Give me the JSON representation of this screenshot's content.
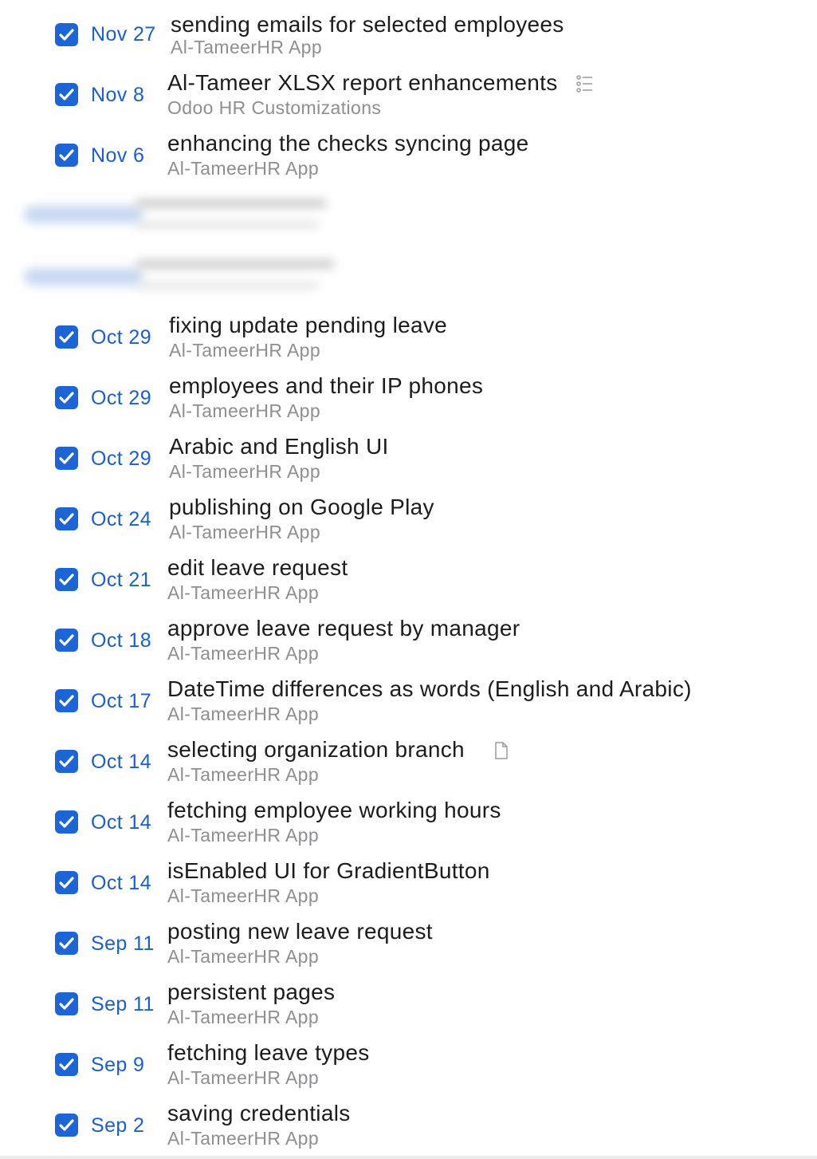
{
  "colors": {
    "accent": "#1d64d6",
    "date": "#1a5fcf",
    "title": "#1c1c1e",
    "project": "#8e8e93"
  },
  "tasks": [
    {
      "done": true,
      "date": "Nov 27",
      "title": "sending emails for selected employees",
      "project": "Al-TameerHR App"
    },
    {
      "done": true,
      "date": "Nov 8",
      "title": "Al-Tameer XLSX report enhancements",
      "project": "Odoo HR Customizations",
      "icon": "checklist-icon"
    },
    {
      "done": true,
      "date": "Nov 6",
      "title": "enhancing the checks syncing page",
      "project": "Al-TameerHR App"
    },
    {
      "done": true,
      "date": "Oct 29",
      "title": "fixing update pending leave",
      "project": "Al-TameerHR App"
    },
    {
      "done": true,
      "date": "Oct 29",
      "title": "employees and their IP phones",
      "project": "Al-TameerHR App"
    },
    {
      "done": true,
      "date": "Oct 29",
      "title": "Arabic and English UI",
      "project": "Al-TameerHR App"
    },
    {
      "done": true,
      "date": "Oct 24",
      "title": "publishing on Google Play",
      "project": "Al-TameerHR App"
    },
    {
      "done": true,
      "date": "Oct 21",
      "title": "edit leave request",
      "project": "Al-TameerHR App"
    },
    {
      "done": true,
      "date": "Oct 18",
      "title": "approve leave request by manager",
      "project": "Al-TameerHR App"
    },
    {
      "done": true,
      "date": "Oct 17",
      "title": "DateTime differences as words (English and Arabic)",
      "project": "Al-TameerHR App"
    },
    {
      "done": true,
      "date": "Oct 14",
      "title": "selecting organization branch",
      "project": "Al-TameerHR App",
      "icon": "note-icon"
    },
    {
      "done": true,
      "date": "Oct 14",
      "title": "fetching employee working hours",
      "project": "Al-TameerHR App"
    },
    {
      "done": true,
      "date": "Oct 14",
      "title": "isEnabled UI for GradientButton",
      "project": "Al-TameerHR App"
    },
    {
      "done": true,
      "date": "Sep 11",
      "title": "posting new leave request",
      "project": "Al-TameerHR App"
    },
    {
      "done": true,
      "date": "Sep 11",
      "title": "persistent pages",
      "project": "Al-TameerHR App"
    },
    {
      "done": true,
      "date": "Sep 9",
      "title": "fetching leave types",
      "project": "Al-TameerHR App"
    },
    {
      "done": true,
      "date": "Sep 2",
      "title": "saving credentials",
      "project": "Al-TameerHR App"
    }
  ]
}
